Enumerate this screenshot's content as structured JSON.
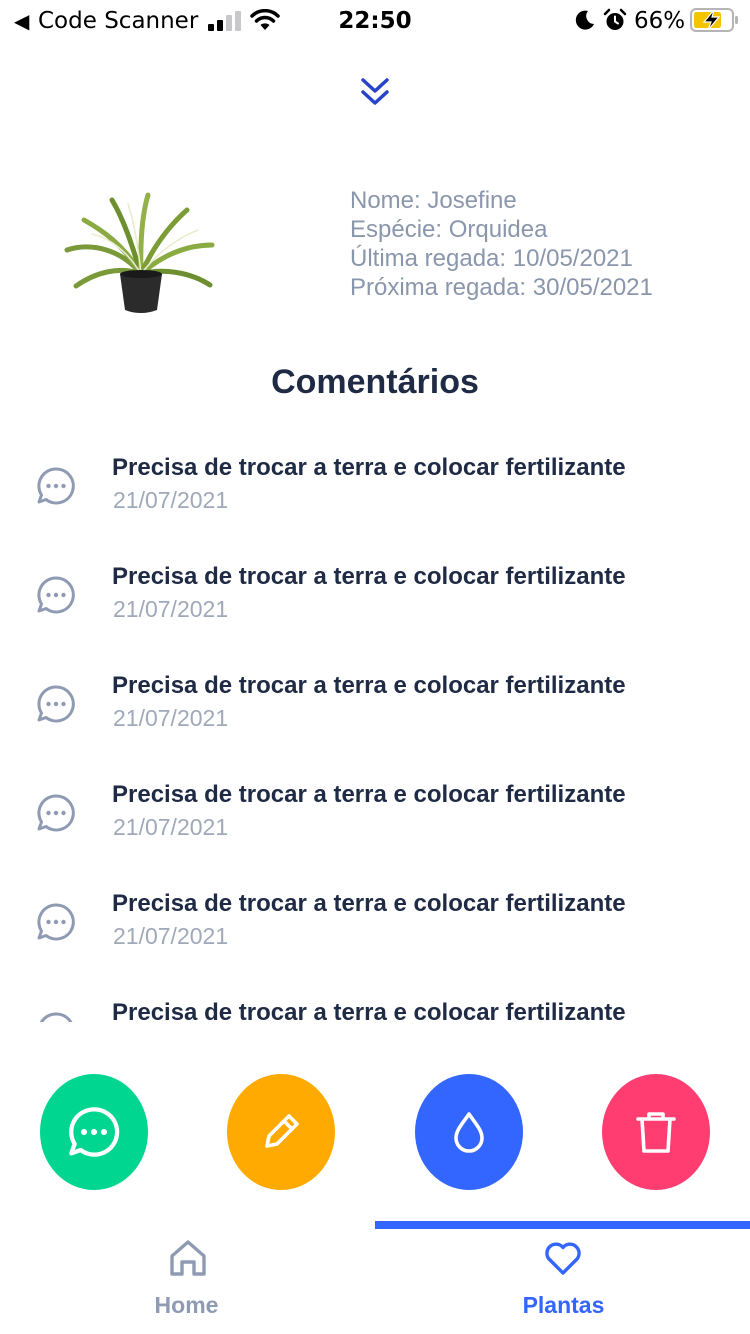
{
  "status_bar": {
    "back_app": "Code Scanner",
    "time": "22:50",
    "battery_percent": "66%",
    "icons": [
      "back-arrow-icon",
      "signal-icon",
      "wifi-icon",
      "moon-icon",
      "alarm-icon",
      "battery-charging-icon"
    ]
  },
  "plant": {
    "image_icon": "plant-photo",
    "name_line": "Nome: Josefine",
    "species_line": "Espécie: Orquidea",
    "last_watered_line": "Última regada: 10/05/2021",
    "next_water_line": "Próxima regada: 30/05/2021"
  },
  "comments_section": {
    "title": "Comentários",
    "items": [
      {
        "text": "Precisa de trocar a terra e colocar fertilizante",
        "date": "21/07/2021"
      },
      {
        "text": "Precisa de trocar a terra e colocar fertilizante",
        "date": "21/07/2021"
      },
      {
        "text": "Precisa de trocar a terra e colocar fertilizante",
        "date": "21/07/2021"
      },
      {
        "text": "Precisa de trocar a terra e colocar fertilizante",
        "date": "21/07/2021"
      },
      {
        "text": "Precisa de trocar a terra e colocar fertilizante",
        "date": "21/07/2021"
      },
      {
        "text": "Precisa de trocar a terra e colocar fertilizante",
        "date": ""
      }
    ]
  },
  "actions": [
    {
      "icon": "comment-icon",
      "color": "#00d68f"
    },
    {
      "icon": "pencil-icon",
      "color": "#ffaa00"
    },
    {
      "icon": "water-drop-icon",
      "color": "#3366ff"
    },
    {
      "icon": "trash-icon",
      "color": "#ff3d71"
    }
  ],
  "tabs": [
    {
      "label": "Home",
      "icon": "home-icon",
      "active": false
    },
    {
      "label": "Plantas",
      "icon": "heart-icon",
      "active": true
    }
  ],
  "colors": {
    "primary": "#3366ff",
    "text_dark": "#1f2a44",
    "text_muted": "#8a96ac"
  }
}
